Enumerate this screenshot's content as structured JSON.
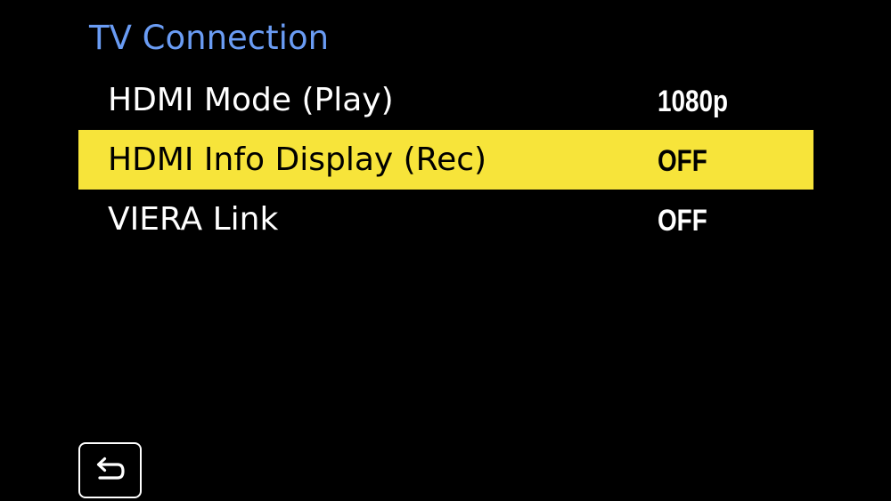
{
  "menu": {
    "title": "TV Connection",
    "items": [
      {
        "label": "HDMI Mode (Play)",
        "value": "1080p",
        "selected": false
      },
      {
        "label": "HDMI Info Display (Rec)",
        "value": "OFF",
        "selected": true
      },
      {
        "label": "VIERA Link",
        "value": "OFF",
        "selected": false
      }
    ]
  },
  "colors": {
    "background": "#000000",
    "title": "#6a9cf4",
    "highlight": "#f7e43a",
    "text": "#ffffff",
    "selected_text": "#000000"
  },
  "icons": {
    "return_button": "return-arrow-icon"
  }
}
